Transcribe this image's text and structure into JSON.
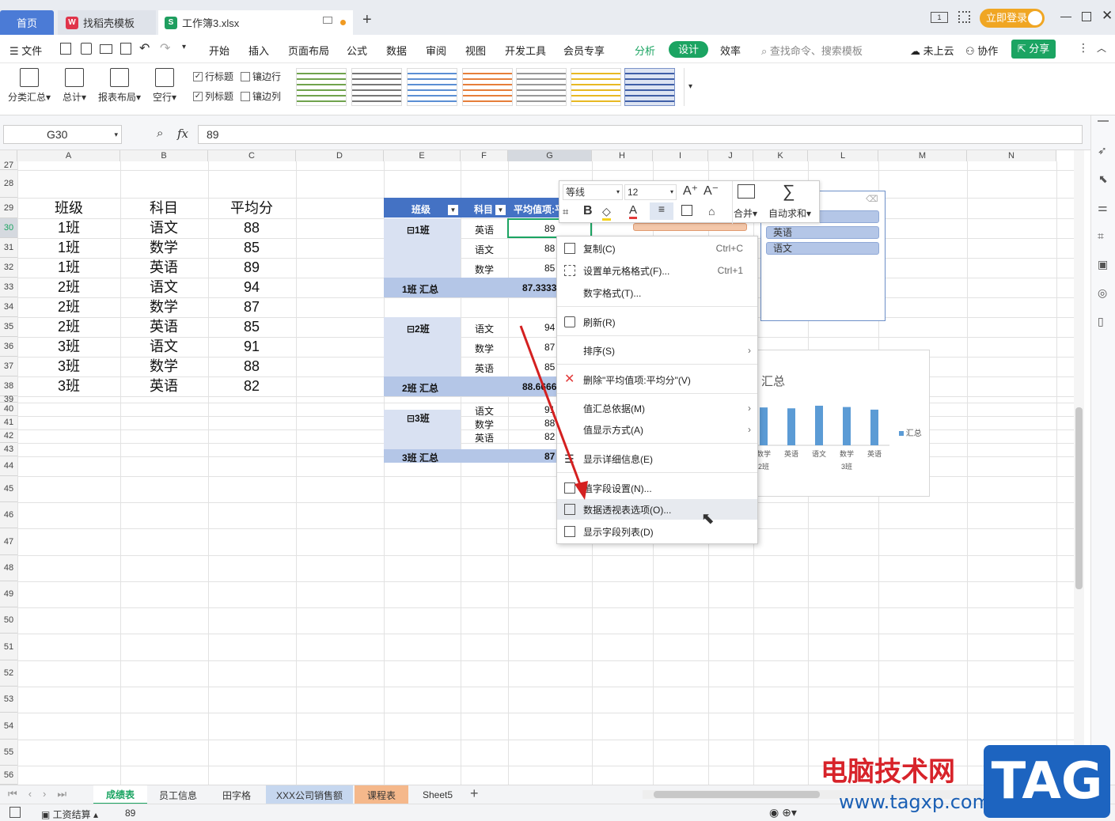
{
  "tabs": {
    "home": "首页",
    "doc": "找稻壳模板",
    "book": "工作簿3.xlsx",
    "login": "立即登录"
  },
  "menu": {
    "file": "文件",
    "items": [
      "开始",
      "插入",
      "页面布局",
      "公式",
      "数据",
      "审阅",
      "视图",
      "开发工具",
      "会员专享"
    ],
    "analysis": "分析",
    "design": "设计",
    "efficiency": "效率",
    "search": "查找命令、搜索模板",
    "cloud": "未上云",
    "collab": "协作",
    "share": "分享"
  },
  "ribbon": {
    "subtotal": "分类汇总",
    "total": "总计",
    "layout": "报表布局",
    "blank": "空行",
    "row_header": "行标题",
    "banded_rows": "镶边行",
    "col_header": "列标题",
    "banded_cols": "镶边列"
  },
  "formula": {
    "cellref": "G30",
    "fx": "fx",
    "value": "89"
  },
  "columns": [
    "A",
    "B",
    "C",
    "D",
    "E",
    "F",
    "G",
    "H",
    "I",
    "J",
    "K",
    "L",
    "M",
    "N"
  ],
  "rows": [
    "27",
    "28",
    "29",
    "30",
    "31",
    "32",
    "33",
    "34",
    "35",
    "36",
    "37",
    "38",
    "39",
    "40",
    "41",
    "42",
    "43",
    "44",
    "45",
    "46",
    "47",
    "48",
    "49",
    "50",
    "51",
    "52",
    "53",
    "54",
    "55",
    "56"
  ],
  "table": {
    "headers": [
      "班级",
      "科目",
      "平均分"
    ],
    "rows": [
      [
        "1班",
        "语文",
        "88"
      ],
      [
        "1班",
        "数学",
        "85"
      ],
      [
        "1班",
        "英语",
        "89"
      ],
      [
        "2班",
        "语文",
        "94"
      ],
      [
        "2班",
        "数学",
        "87"
      ],
      [
        "2班",
        "英语",
        "85"
      ],
      [
        "3班",
        "语文",
        "91"
      ],
      [
        "3班",
        "数学",
        "88"
      ],
      [
        "3班",
        "英语",
        "82"
      ]
    ]
  },
  "pivot": {
    "h1": "班级",
    "h2": "科目",
    "h3": "平均值项:平",
    "g1": "⊟1班",
    "g2": "⊟2班",
    "g3": "⊟3班",
    "s1": "1班 汇总",
    "s2": "2班 汇总",
    "s3": "3班 汇总",
    "v1": "87.3333",
    "v2": "88.6666",
    "v3": "87",
    "r1": [
      [
        "英语",
        "89"
      ],
      [
        "语文",
        "88"
      ],
      [
        "数学",
        "85"
      ]
    ],
    "r2": [
      [
        "语文",
        "94"
      ],
      [
        "数学",
        "87"
      ],
      [
        "英语",
        "85"
      ]
    ],
    "r3": [
      [
        "语文",
        "91"
      ],
      [
        "数学",
        "88"
      ],
      [
        "英语",
        "82"
      ]
    ]
  },
  "mini": {
    "font": "等线",
    "size": "12",
    "merge": "合并",
    "autosum": "自动求和"
  },
  "slicer": {
    "items": [
      "英语",
      "语文"
    ]
  },
  "chart": {
    "title": "汇总",
    "legend": "汇总",
    "xlabels": [
      "数学",
      "英语",
      "语文",
      "数学",
      "英语"
    ],
    "groups": [
      "2班",
      "3班"
    ]
  },
  "context_menu": {
    "copy": "复制(C)",
    "copy_sc": "Ctrl+C",
    "format": "设置单元格格式(F)...",
    "format_sc": "Ctrl+1",
    "number": "数字格式(T)...",
    "refresh": "刷新(R)",
    "sort": "排序(S)",
    "delete": "删除\"平均值项:平均分\"(V)",
    "summarize": "值汇总依据(M)",
    "show_as": "值显示方式(A)",
    "details": "显示详细信息(E)",
    "field_settings": "值字段设置(N)...",
    "pivot_options": "数据透视表选项(O)...",
    "field_list": "显示字段列表(D)"
  },
  "sheets": [
    "成绩表",
    "员工信息",
    "田字格",
    "XXX公司销售额",
    "课程表",
    "Sheet5"
  ],
  "status": {
    "macro": "工资结算",
    "value": "89"
  },
  "watermark": {
    "site": "电脑技术网",
    "url": "www.tagxp.com",
    "tag": "TAG"
  }
}
